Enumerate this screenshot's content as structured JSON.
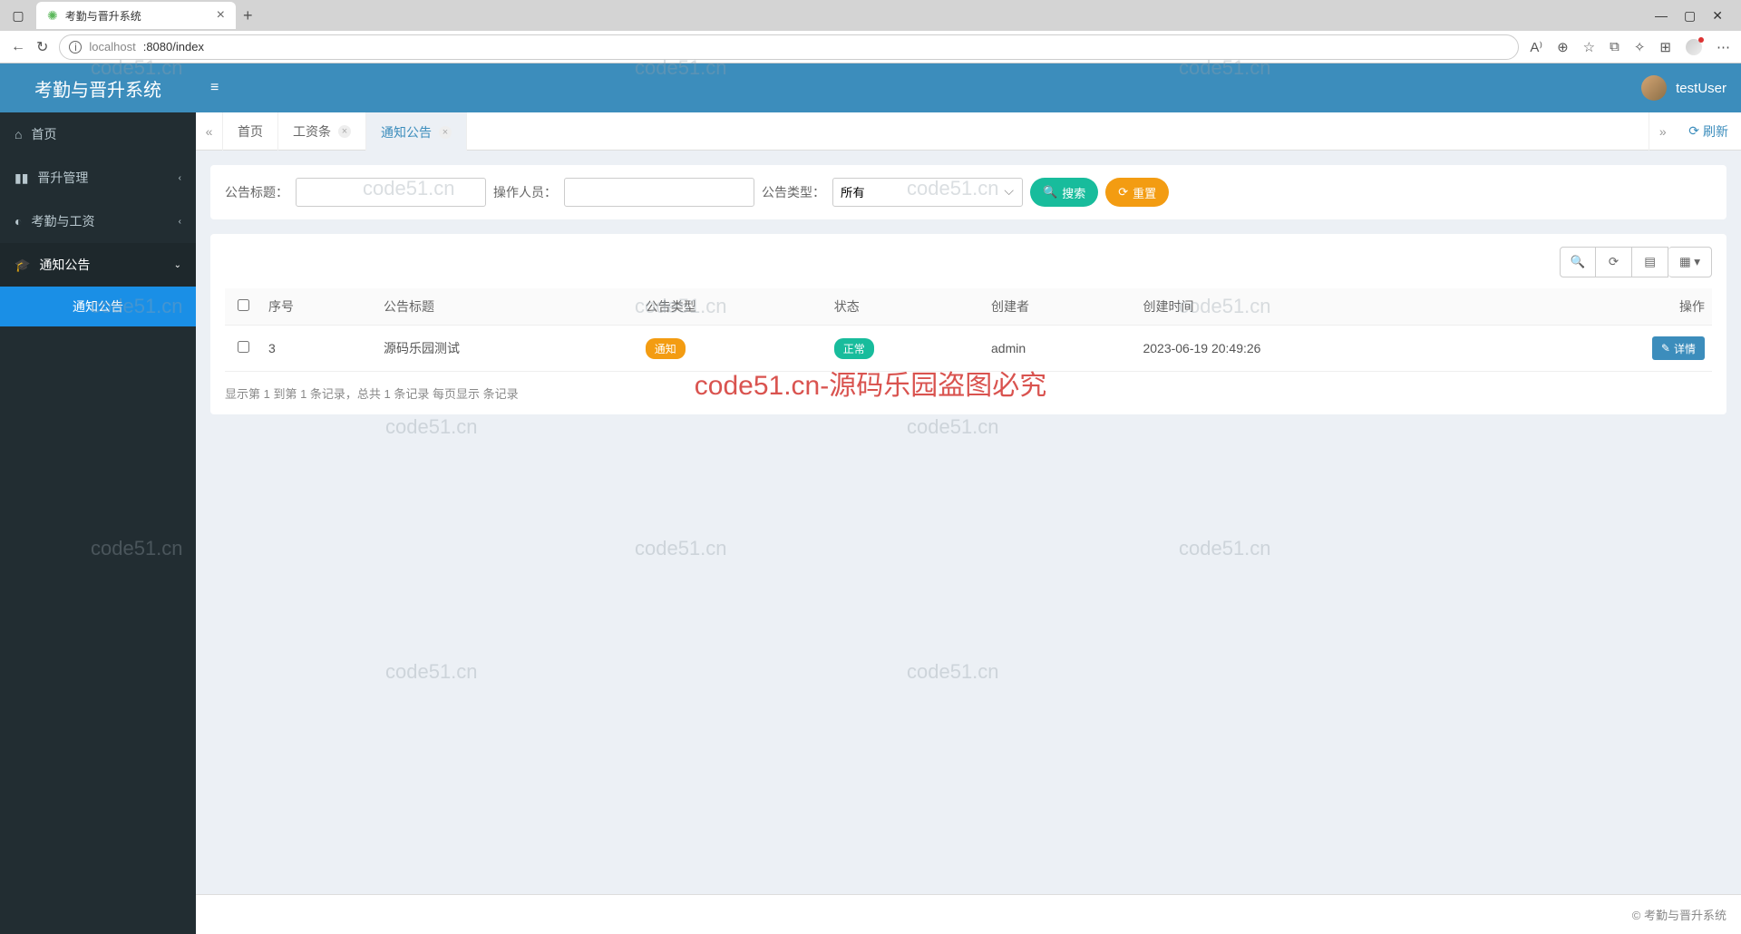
{
  "browser": {
    "tab_title": "考勤与晋升系统",
    "url_host": "localhost",
    "url_port_path": ":8080/index"
  },
  "app": {
    "brand": "考勤与晋升系统",
    "username": "testUser",
    "footer_copyright": "© 考勤与晋升系统"
  },
  "sidebar": {
    "home": "首页",
    "promotion": "晋升管理",
    "attendance": "考勤与工资",
    "notice": "通知公告",
    "notice_sub": "通知公告"
  },
  "tabs": {
    "home": "首页",
    "payroll": "工资条",
    "notice": "通知公告",
    "refresh": "刷新"
  },
  "filter": {
    "title_label": "公告标题：",
    "operator_label": "操作人员：",
    "type_label": "公告类型：",
    "type_value": "所有",
    "search_btn": "搜索",
    "reset_btn": "重置"
  },
  "table": {
    "headers": {
      "seq": "序号",
      "title": "公告标题",
      "type": "公告类型",
      "status": "状态",
      "creator": "创建者",
      "create_time": "创建时间",
      "action": "操作"
    },
    "rows": [
      {
        "seq": "3",
        "title": "源码乐园测试",
        "type_badge": "通知",
        "status_badge": "正常",
        "creator": "admin",
        "create_time": "2023-06-19 20:49:26",
        "action_label": "详情"
      }
    ],
    "pagination": "显示第 1 到第 1 条记录，总共 1 条记录  每页显示           条记录"
  },
  "watermarks": {
    "text": "code51.cn",
    "red": "code51.cn-源码乐园盗图必究"
  }
}
